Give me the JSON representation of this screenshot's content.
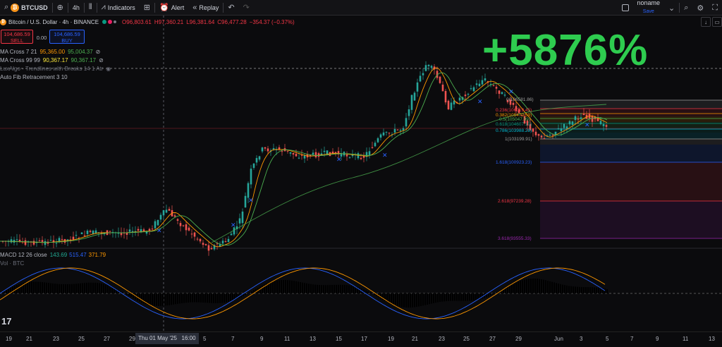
{
  "toolbar": {
    "symbol": "BTCUSD",
    "interval": "4h",
    "indicators": "Indicators",
    "alert": "Alert",
    "replay": "Replay",
    "user": "noname",
    "save": "Save"
  },
  "legend": {
    "title": "Bitcoin / U.S. Dollar · 4h · BINANCE",
    "ohlc": {
      "o": "O96,803.61",
      "h": "H97,360.21",
      "l": "L96,381.64",
      "c": "C96,477.28",
      "chg": "−354.37 (−0.37%)"
    },
    "sell_price": "104,686.59",
    "sell": "SELL",
    "spread": "0.00",
    "buy_price": "104,686.59",
    "buy": "BUY",
    "ma1_name": "MA Cross 7 21",
    "ma1_v1": "95,365.00",
    "ma1_v2": "95,004.37",
    "ma2_name": "MA Cross 99 99",
    "ma2_v1": "90,367.17",
    "ma2_v2": "90,367.17",
    "lux": "LuxAlgo - Trendlines with Breaks 14 1 Atr",
    "fib": "Auto Fib Retracement 3 10",
    "macd_name": "MACD 12 26 close",
    "macd_v1": "143.69",
    "macd_v2": "515.47",
    "macd_v3": "371.79",
    "vol": "Vol · BTC"
  },
  "overlay": {
    "gain": "+5876%"
  },
  "fib_levels": [
    {
      "label": "0(106581.86)",
      "color": "#9e9e9e"
    },
    {
      "label": "0.236(106019.45)",
      "color": "#f23645"
    },
    {
      "label": "0.382(105470.59)",
      "color": "#ff9800"
    },
    {
      "label": "0.5(105047.99)",
      "color": "#4caf50"
    },
    {
      "label": "0.618(104607.10)",
      "color": "#089981"
    },
    {
      "label": "0.786(103988.28)",
      "color": "#00bcd4"
    },
    {
      "label": "1(103199.91)",
      "color": "#9e9e9e"
    },
    {
      "label": "1.618(100923.23)",
      "color": "#2962ff"
    },
    {
      "label": "2.618(97239.28)",
      "color": "#f23645"
    },
    {
      "label": "3.618(93555.33)",
      "color": "#9c27b0"
    }
  ],
  "xaxis": {
    "ticks": [
      "19",
      "21",
      "23",
      "25",
      "27",
      "29",
      "3",
      "5",
      "7",
      "9",
      "11",
      "13",
      "15",
      "17",
      "19",
      "21",
      "23",
      "25",
      "27",
      "29",
      "Jun",
      "3",
      "5",
      "7",
      "9",
      "11",
      "13"
    ],
    "highlight": "Thu 01 May '25   16:00"
  },
  "colors": {
    "up": "#26a69a",
    "down": "#ef5350",
    "accent": "#2962ff",
    "gain": "#2ecc4f"
  }
}
